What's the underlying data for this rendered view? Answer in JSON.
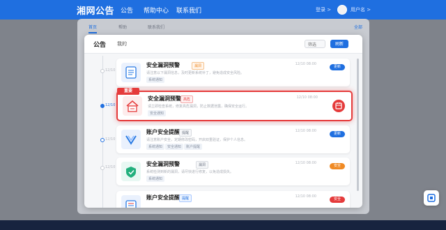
{
  "header": {
    "logo": "湘网公告",
    "nav": [
      "公告",
      "帮助中心",
      "联系我们"
    ],
    "links": [
      "登录 >",
      "用户名 >"
    ]
  },
  "background": {
    "tabs": [
      "首页",
      "帮助",
      "联系我们"
    ],
    "right_action": "全部"
  },
  "modal": {
    "title": "公告",
    "subtitle": "我的",
    "filter_label": "筛选",
    "confirm_label": "刷新"
  },
  "items": [
    {
      "title": "安全漏洞预警",
      "badge": "漏洞",
      "desc": "请注意以下漏洞信息，及时更新系统补丁，避免造成安全风险。",
      "chips": [
        "系统通知"
      ],
      "time": "12/10 08:00",
      "action": "更新",
      "important": false
    },
    {
      "title": "安全漏洞预警",
      "badge": "高危",
      "desc": "请立即检查系统，修复高危漏洞，防止数据泄露，确保安全运行。",
      "chips": [
        "安全通知"
      ],
      "time": "12/10 08:00",
      "action": "",
      "important": true
    },
    {
      "title": "账户安全提醒",
      "badge": "提醒",
      "desc": "请注意账户安全，定期修改密码，开启双重验证，保护个人信息。",
      "chips": [
        "系统通知",
        "安全通知",
        "账户提醒"
      ],
      "time": "12/10 08:00",
      "action": "更新",
      "important": false
    },
    {
      "title": "安全漏洞预警",
      "badge": "漏洞",
      "desc": "系统检测到新的漏洞，请尽快进行修复，以免造成损失。",
      "chips": [
        "系统通知"
      ],
      "time": "12/10 08:00",
      "action": "安全",
      "important": false
    },
    {
      "title": "账户安全提醒",
      "badge": "提醒",
      "desc": "",
      "chips": [],
      "time": "12/10 08:00",
      "action": "安全",
      "important": false
    }
  ],
  "timeline_dates": [
    "12/10",
    "12/10",
    "12/10",
    "12/10"
  ],
  "important_label": "重要",
  "colors": {
    "primary": "#1f6fe0",
    "danger": "#e53b3b",
    "warning": "#f08a24"
  }
}
